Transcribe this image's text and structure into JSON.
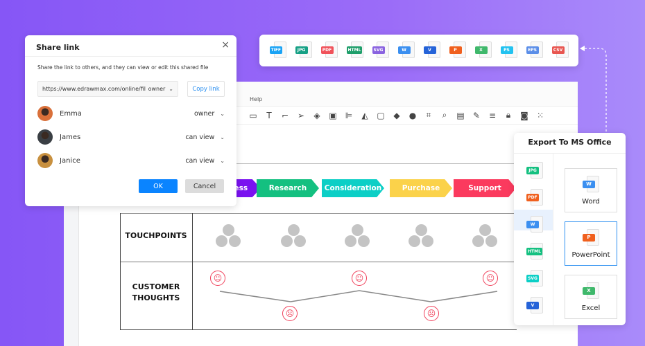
{
  "formats": [
    {
      "label": "TIFF",
      "color": "#1aa3f5"
    },
    {
      "label": "JPG",
      "color": "#16a085"
    },
    {
      "label": "PDF",
      "color": "#f0525a"
    },
    {
      "label": "HTML",
      "color": "#1e9e6a"
    },
    {
      "label": "SVG",
      "color": "#8a63e0"
    },
    {
      "label": "W",
      "color": "#3b8ff0"
    },
    {
      "label": "V",
      "color": "#2563d8"
    },
    {
      "label": "P",
      "color": "#f0601e"
    },
    {
      "label": "X",
      "color": "#3fb86b"
    },
    {
      "label": "PS",
      "color": "#22c2f0"
    },
    {
      "label": "EPS",
      "color": "#5b8ee8"
    },
    {
      "label": "CSV",
      "color": "#e85650"
    }
  ],
  "editor": {
    "menu_help": "Help"
  },
  "diagram": {
    "stages": [
      {
        "label": "Awareness",
        "color": "#7a12f0"
      },
      {
        "label": "Research",
        "color": "#14c080"
      },
      {
        "label": "Consideration",
        "color": "#0ccfc6"
      },
      {
        "label": "Purchase",
        "color": "#fbd24a"
      },
      {
        "label": "Support",
        "color": "#fb3a5e"
      }
    ],
    "rows": {
      "touchpoints": "TOUCHPOINTS",
      "thoughts_line1": "CUSTOMER",
      "thoughts_line2": "THOUGHTS"
    },
    "thoughts": [
      "happy",
      "sad",
      "happy",
      "sad",
      "happy"
    ]
  },
  "share": {
    "title": "Share link",
    "description": "Share the link to others, and they can view or edit this shared file",
    "link_value": "https://www.edrawmax.com/online/fil",
    "link_permission": "owner",
    "copy_label": "Copy link",
    "people": [
      {
        "name": "Emma",
        "permission": "owner",
        "color": "#d9703a"
      },
      {
        "name": "James",
        "permission": "can view",
        "color": "#3a3f44"
      },
      {
        "name": "Janice",
        "permission": "can view",
        "color": "#c8903f"
      }
    ],
    "ok_label": "OK",
    "cancel_label": "Cancel"
  },
  "export": {
    "title": "Export To MS Office",
    "side_formats": [
      {
        "label": "JPG",
        "color": "#14c080"
      },
      {
        "label": "PDF",
        "color": "#f0601e"
      },
      {
        "label": "W",
        "color": "#3b8ff0"
      },
      {
        "label": "HTML",
        "color": "#14c080"
      },
      {
        "label": "SVG",
        "color": "#0ccfc6"
      },
      {
        "label": "V",
        "color": "#2563d8"
      }
    ],
    "options": [
      {
        "label": "Word",
        "tag": "W",
        "color": "#3b8ff0"
      },
      {
        "label": "PowerPoint",
        "tag": "P",
        "color": "#f0601e"
      },
      {
        "label": "Excel",
        "tag": "X",
        "color": "#3fb86b"
      }
    ]
  },
  "colors": {
    "accent": "#0a84ff",
    "selected_bg": "#e8f1fd"
  }
}
